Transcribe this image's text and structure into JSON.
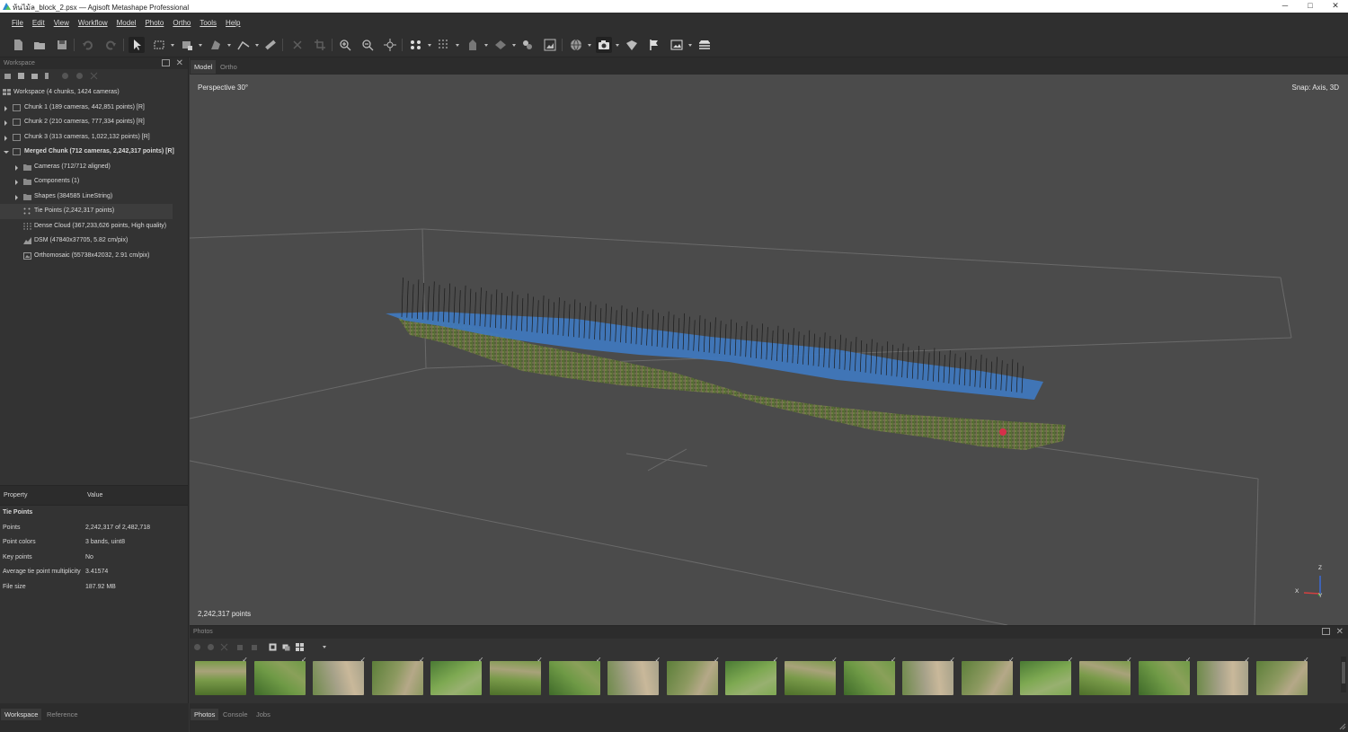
{
  "window": {
    "title": "ห้นไม้ล_block_2.psx — Agisoft Metashape Professional",
    "minimize": "─",
    "maximize": "□",
    "close": "✕"
  },
  "menu": [
    "File",
    "Edit",
    "View",
    "Workflow",
    "Model",
    "Photo",
    "Ortho",
    "Tools",
    "Help"
  ],
  "workspace": {
    "header": "Workspace",
    "tree": [
      {
        "label": "Workspace (4 chunks, 1424 cameras)",
        "indent": 0
      },
      {
        "label": "Chunk 1 (189 cameras, 442,851 points) [R]",
        "indent": 1
      },
      {
        "label": "Chunk 2 (210 cameras, 777,334 points) [R]",
        "indent": 1
      },
      {
        "label": "Chunk 3 (313 cameras, 1,022,132 points) [R]",
        "indent": 1
      },
      {
        "label": "Merged Chunk (712 cameras, 2,242,317 points) [R]",
        "indent": 1
      },
      {
        "label": "Cameras (712/712 aligned)",
        "indent": 2
      },
      {
        "label": "Components (1)",
        "indent": 2
      },
      {
        "label": "Shapes (384585 LineString)",
        "indent": 2
      },
      {
        "label": "Tie Points (2,242,317 points)",
        "indent": 2
      },
      {
        "label": "Dense Cloud (367,233,626 points, High quality)",
        "indent": 2
      },
      {
        "label": "DSM (47840x37705, 5.82 cm/pix)",
        "indent": 2
      },
      {
        "label": "Orthomosaic (55738x42032, 2.91 cm/pix)",
        "indent": 2
      }
    ]
  },
  "properties": {
    "col_property": "Property",
    "col_value": "Value",
    "group": "Tie Points",
    "rows": [
      {
        "k": "Points",
        "v": "2,242,317 of 2,482,718"
      },
      {
        "k": "Point colors",
        "v": "3 bands, uint8"
      },
      {
        "k": "Key points",
        "v": "No"
      },
      {
        "k": "Average tie point multiplicity",
        "v": "3.41574"
      },
      {
        "k": "File size",
        "v": "187.92 MB"
      }
    ]
  },
  "left_tabs": [
    "Workspace",
    "Reference"
  ],
  "view": {
    "tabs": [
      "Model",
      "Ortho"
    ],
    "perspective": "Perspective 30°",
    "snap": "Snap: Axis, 3D",
    "points": "2,242,317 points",
    "axes": {
      "x": "X",
      "y": "Y",
      "z": "Z"
    }
  },
  "photos": {
    "header": "Photos",
    "count": 19,
    "check": "✓"
  },
  "bottom_tabs": [
    "Photos",
    "Console",
    "Jobs"
  ],
  "colors": {
    "background": "#4b4b4b",
    "panel": "#333333",
    "plane_blue": "#3f78bf",
    "terrain_green": "#4f6a2c"
  }
}
